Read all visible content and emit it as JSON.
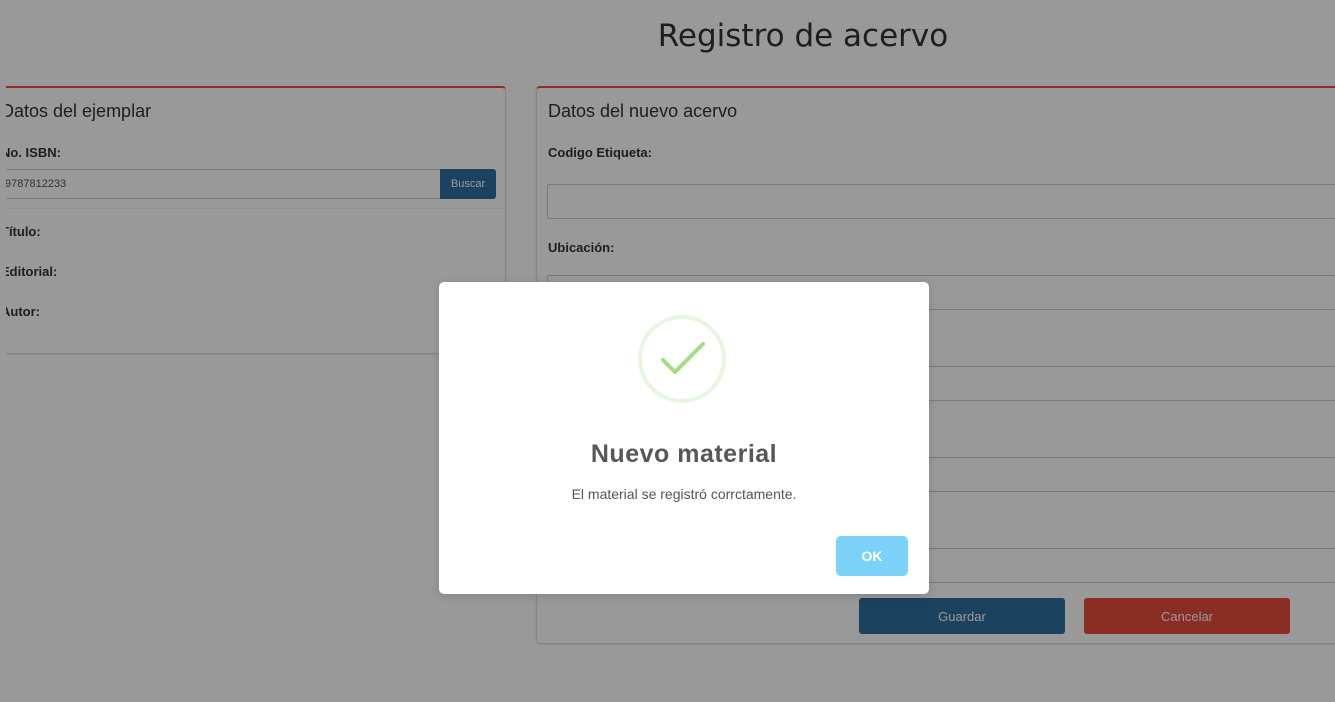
{
  "page": {
    "title": "Registro de acervo"
  },
  "left_panel": {
    "heading": "Datos del ejemplar",
    "isbn_label": "No. ISBN:",
    "isbn_value": "9787812233",
    "search_button": "Buscar",
    "titulo_label": "Título:",
    "editorial_label": "Editorial:",
    "autor_label": "Autor:"
  },
  "right_panel": {
    "heading": "Datos del nuevo acervo",
    "codigo_label": "Codigo Etiqueta:",
    "codigo_value": "",
    "ubicacion_label": "Ubicación:",
    "ubicacion_value": "",
    "save_button": "Guardar",
    "cancel_button": "Cancelar"
  },
  "modal": {
    "icon": "check-icon",
    "title": "Nuevo material",
    "text": "El material se registró corrctamente.",
    "ok_button": "OK"
  },
  "colors": {
    "accent_red": "#e74c3c",
    "primary_blue": "#2e6f9e",
    "ok_button": "#7cd1f9",
    "success_green": "#a5dc86"
  }
}
